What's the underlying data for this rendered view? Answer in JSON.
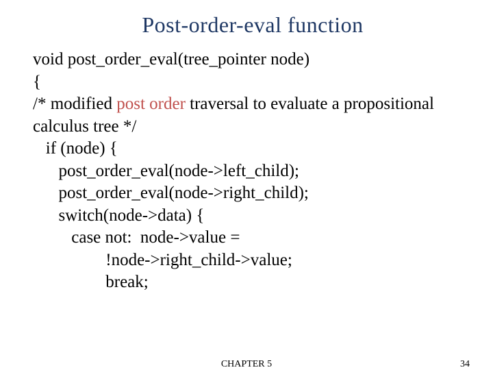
{
  "title": "Post-order-eval function",
  "code": {
    "l1": "void post_order_eval(tree_pointer node)",
    "l2": "{",
    "l3a": "/* modified ",
    "l3b": "post order",
    "l3c": " traversal to evaluate a propositional",
    "l4": "calculus tree */",
    "l5": "   if (node) {",
    "l6": "      post_order_eval(node->left_child);",
    "l7": "      post_order_eval(node->right_child);",
    "l8": "      switch(node->data) {",
    "l9": "         case not:  node->value =",
    "l10": "                 !node->right_child->value;",
    "l11": "                 break;"
  },
  "footer": {
    "chapter": "CHAPTER 5",
    "page": "34"
  }
}
